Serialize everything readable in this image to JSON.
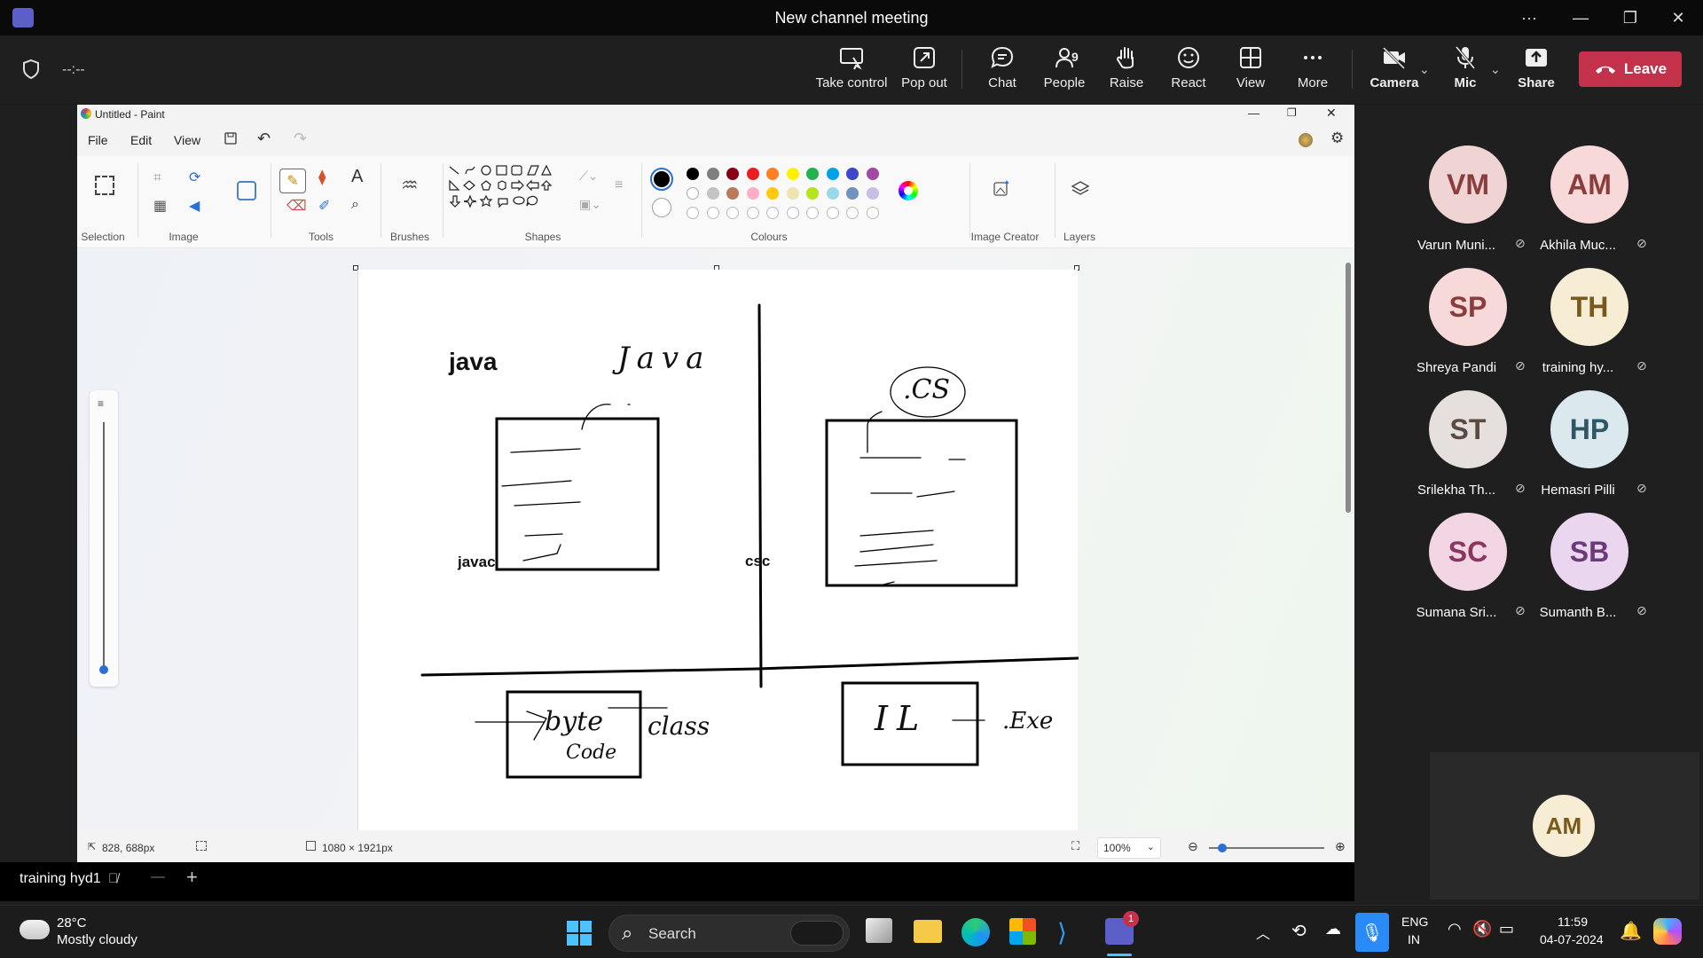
{
  "meeting": {
    "title": "New channel meeting",
    "timer": "--:--",
    "toolbar": [
      {
        "id": "take-control",
        "label": "Take control"
      },
      {
        "id": "pop-out",
        "label": "Pop out"
      },
      {
        "id": "chat",
        "label": "Chat"
      },
      {
        "id": "people",
        "label": "People",
        "count": "9"
      },
      {
        "id": "raise",
        "label": "Raise"
      },
      {
        "id": "react",
        "label": "React"
      },
      {
        "id": "view",
        "label": "View"
      },
      {
        "id": "more",
        "label": "More"
      },
      {
        "id": "camera",
        "label": "Camera"
      },
      {
        "id": "mic",
        "label": "Mic"
      },
      {
        "id": "share",
        "label": "Share"
      }
    ],
    "leave_label": "Leave",
    "presenter_label": "training hyd1",
    "participants": [
      {
        "initials": "VM",
        "name": "Varun Muni...",
        "bg": "#f0d3d3",
        "fg": "#8a3d3d"
      },
      {
        "initials": "AM",
        "name": "Akhila Muc...",
        "bg": "#f7d9d9",
        "fg": "#8a3d3d"
      },
      {
        "initials": "SP",
        "name": "Shreya Pandi",
        "bg": "#f7d9d9",
        "fg": "#8a3d3d"
      },
      {
        "initials": "TH",
        "name": "training hy...",
        "bg": "#f7ecd4",
        "fg": "#7a5a1c"
      },
      {
        "initials": "ST",
        "name": "Srilekha Th...",
        "bg": "#e5e0de",
        "fg": "#5a4a44"
      },
      {
        "initials": "HP",
        "name": "Hemasri Pilli",
        "bg": "#dbe8ee",
        "fg": "#2e5866"
      },
      {
        "initials": "SC",
        "name": "Sumana Sri...",
        "bg": "#f2d6e4",
        "fg": "#8a3660"
      },
      {
        "initials": "SB",
        "name": "Sumanth B...",
        "bg": "#ead6ee",
        "fg": "#6c3a78"
      }
    ],
    "self_initials": "AM"
  },
  "paint": {
    "window_title": "Untitled - Paint",
    "menu": [
      "File",
      "Edit",
      "View"
    ],
    "groups": [
      "Selection",
      "Image",
      "Tools",
      "Brushes",
      "Shapes",
      "Colours",
      "Image Creator",
      "Layers"
    ],
    "palette_row1": [
      "#000000",
      "#7f7f7f",
      "#880015",
      "#ed1c24",
      "#ff7f27",
      "#fff200",
      "#22b14c",
      "#00a2e8",
      "#3f48cc",
      "#a349a4"
    ],
    "palette_row2": [
      "#ffffff",
      "#c3c3c3",
      "#b97a57",
      "#ffaec9",
      "#ffc90e",
      "#efe4b0",
      "#b5e61d",
      "#99d9ea",
      "#7092be",
      "#c8bfe7"
    ],
    "canvas_text": {
      "java": "java",
      "javac": "javac",
      "csc": "csc",
      "hand_java": "Java",
      "hand_cs": ".CS",
      "hand_byte": "byte",
      "hand_code": "Code",
      "hand_class": "class",
      "hand_il": "IL",
      "hand_exe": ".Exe"
    },
    "status": {
      "cursor": "828, 688px",
      "size": "1080 × 1921px",
      "zoom": "100%"
    }
  },
  "taskbar": {
    "weather_temp": "28°C",
    "weather_desc": "Mostly cloudy",
    "search_label": "Search",
    "lang_top": "ENG",
    "lang_bottom": "IN",
    "time": "11:59",
    "date": "04-07-2024",
    "teams_badge": "1"
  }
}
